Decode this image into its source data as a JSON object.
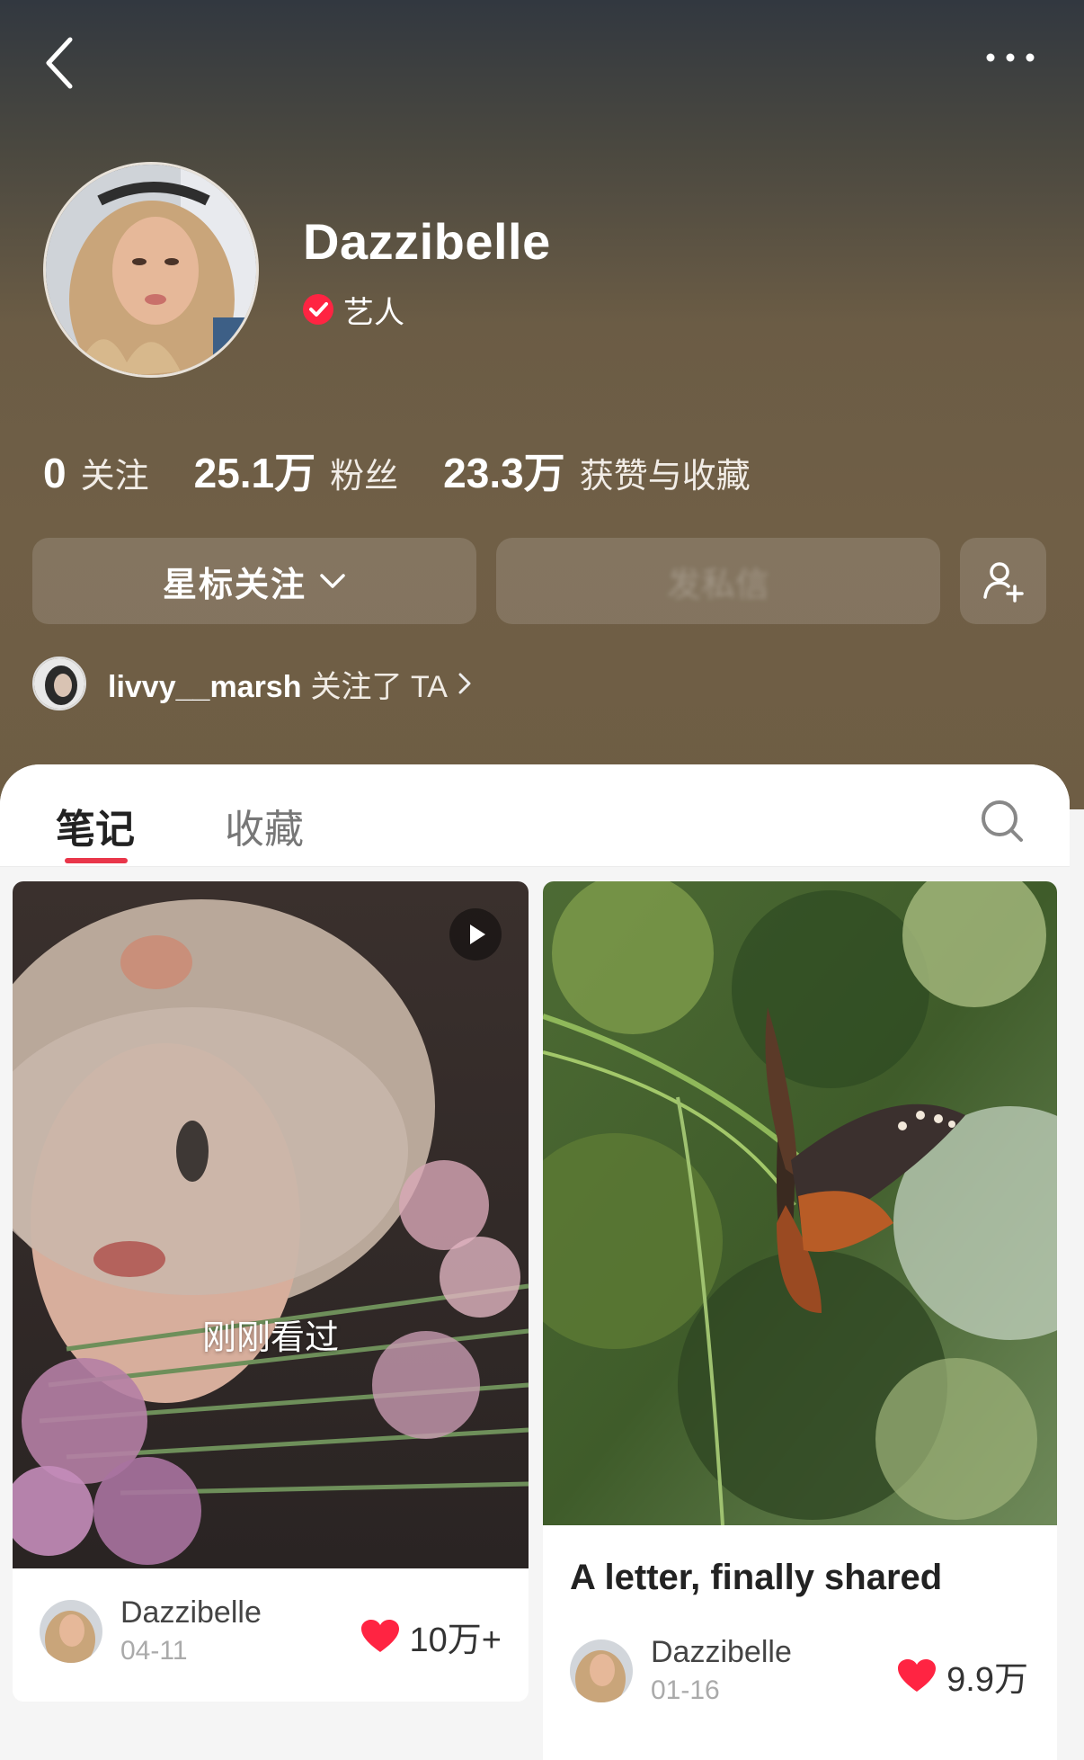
{
  "profile": {
    "name": "Dazzibelle",
    "verified_label": "艺人",
    "stats": [
      {
        "value": "0",
        "label": "关注"
      },
      {
        "value": "25.1万",
        "label": "粉丝"
      },
      {
        "value": "23.3万",
        "label": "获赞与收藏"
      }
    ],
    "buttons": {
      "star_follow": "星标关注",
      "message": "发私信"
    },
    "followed_by": {
      "user": "livvy__marsh",
      "text": "关注了 TA"
    }
  },
  "tabs": [
    {
      "label": "笔记",
      "active": true
    },
    {
      "label": "收藏",
      "active": false
    }
  ],
  "notes": [
    {
      "title": "",
      "seen_label": "刚刚看过",
      "author": "Dazzibelle",
      "date": "04-11",
      "likes": "10万+",
      "is_video": true
    },
    {
      "title": "A letter, finally shared",
      "author": "Dazzibelle",
      "date": "01-16",
      "likes": "9.9万",
      "is_video": false
    }
  ],
  "colors": {
    "accent": "#e9364a",
    "header_top": "#323840",
    "header_bottom": "#6e5d44"
  },
  "icons": [
    "back-icon",
    "more-icon",
    "verified-icon",
    "chevron-down-icon",
    "add-user-icon",
    "chevron-right-icon",
    "search-icon",
    "play-icon",
    "heart-icon"
  ]
}
